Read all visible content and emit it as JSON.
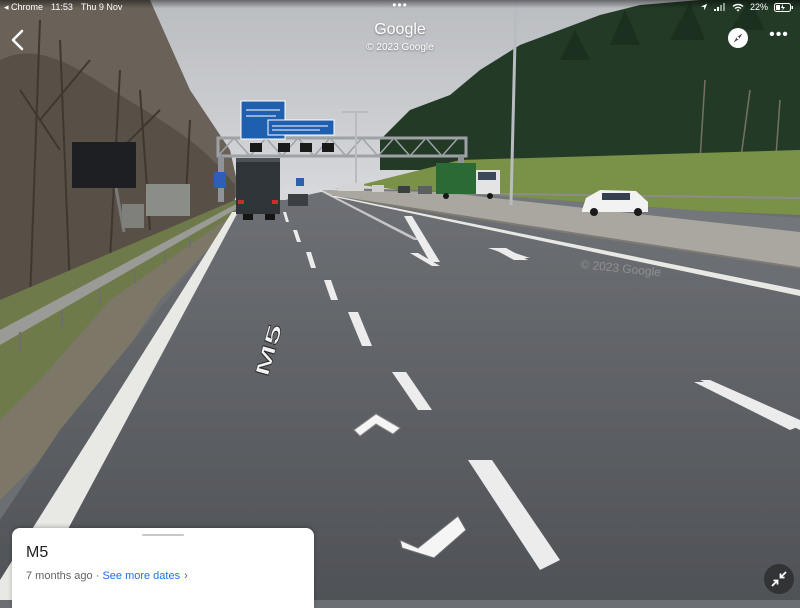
{
  "status_bar": {
    "back_app": "◂ Chrome",
    "time": "11:53",
    "date": "Thu 9 Nov",
    "battery": "22%"
  },
  "header": {
    "title": "Google",
    "copyright": "© 2023 Google"
  },
  "road_marking": "M5",
  "watermark": "© 2023 Google",
  "info_card": {
    "title": "M5",
    "age": "7 months ago · ",
    "more_dates": "See more dates",
    "chevron": "›"
  },
  "colors": {
    "sky": "#c9ccd0",
    "tarmac": "#5f6266",
    "grass": "#6e8a3c",
    "trees": "#243a25",
    "sign_blue": "#1f5fb0",
    "link": "#1a73e8"
  }
}
